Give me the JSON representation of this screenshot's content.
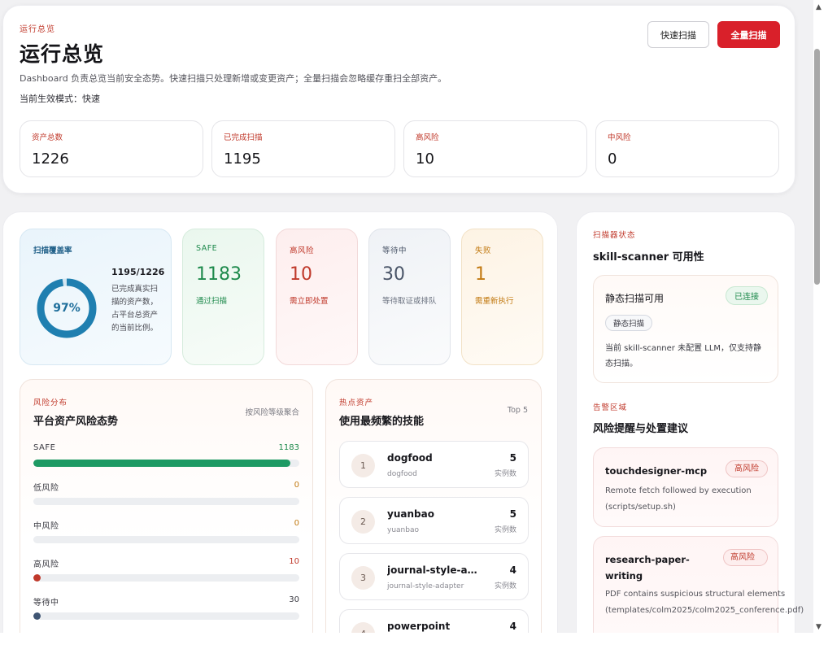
{
  "header": {
    "eyebrow": "运行总览",
    "title": "运行总览",
    "description": "Dashboard 负责总览当前安全态势。快速扫描只处理新增或变更资产；全量扫描会忽略缓存重扫全部资产。",
    "mode": "当前生效模式：快速",
    "quick_scan_label": "快速扫描",
    "full_scan_label": "全量扫描",
    "stats": [
      {
        "label": "资产总数",
        "value": "1226"
      },
      {
        "label": "已完成扫描",
        "value": "1195"
      },
      {
        "label": "高风险",
        "value": "10"
      },
      {
        "label": "中风险",
        "value": "0"
      }
    ]
  },
  "coverage": {
    "label": "扫描覆盖率",
    "percent_text": "97%",
    "percent": 97.5,
    "fraction": "1195/1226",
    "description": "已完成真实扫描的资产数，占平台总资产的当前比例。",
    "color": "#1f7fb0"
  },
  "tiles": [
    {
      "label": "SAFE",
      "value": "1183",
      "desc": "通过扫描",
      "color": "#1e8a4c"
    },
    {
      "label": "高风险",
      "value": "10",
      "desc": "需立即处置",
      "color": "#c0392b"
    },
    {
      "label": "等待中",
      "value": "30",
      "desc": "等待取证或排队",
      "color": "#4a5568"
    },
    {
      "label": "失败",
      "value": "1",
      "desc": "需重新执行",
      "color": "#c27a12"
    }
  ],
  "risk": {
    "eyebrow": "风险分布",
    "title": "平台资产风险态势",
    "right_label": "按风险等级聚合",
    "total": 1226,
    "bars": [
      {
        "label": "SAFE",
        "count": "1183",
        "value": 1183,
        "color": "#1e9a64",
        "count_color": "#1e8a4c"
      },
      {
        "label": "低风险",
        "count": "0",
        "value": 0,
        "color": "#c27a12",
        "count_color": "#c27a12"
      },
      {
        "label": "中风险",
        "count": "0",
        "value": 0,
        "color": "#c27a12",
        "count_color": "#c27a12"
      },
      {
        "label": "高风险",
        "count": "10",
        "value": 10,
        "color": "#c0392b",
        "count_color": "#c0392b"
      },
      {
        "label": "等待中",
        "count": "30",
        "value": 30,
        "color": "#3f5573",
        "count_color": "#3a3a42"
      }
    ]
  },
  "hot": {
    "eyebrow": "热点资产",
    "title": "使用最频繁的技能",
    "right_label": "Top 5",
    "items": [
      {
        "rank": "1",
        "name": "dogfood",
        "sub": "dogfood",
        "count": "5",
        "unit": "实例数"
      },
      {
        "rank": "2",
        "name": "yuanbao",
        "sub": "yuanbao",
        "count": "5",
        "unit": "实例数"
      },
      {
        "rank": "3",
        "name": "journal-style-ad...",
        "sub": "journal-style-adapter",
        "count": "4",
        "unit": "实例数"
      },
      {
        "rank": "4",
        "name": "powerpoint",
        "sub": "",
        "count": "4",
        "unit": ""
      }
    ]
  },
  "scanner": {
    "eyebrow": "扫描器状态",
    "title": "skill-scanner 可用性",
    "name": "静态扫描可用",
    "status": "已连接",
    "chip": "静态扫描",
    "note": "当前 skill-scanner 未配置 LLM，仅支持静态扫描。"
  },
  "alerts": {
    "eyebrow": "告警区域",
    "title": "风险提醒与处置建议",
    "items": [
      {
        "name": "touchdesigner-mcp",
        "badge": "高风险",
        "desc": "Remote fetch followed by execution (scripts/setup.sh)"
      },
      {
        "name": "research-paper-writing",
        "badge": "高风险",
        "desc": "PDF contains suspicious structural elements (templates/colm2025/colm2025_conference.pdf)"
      }
    ]
  }
}
